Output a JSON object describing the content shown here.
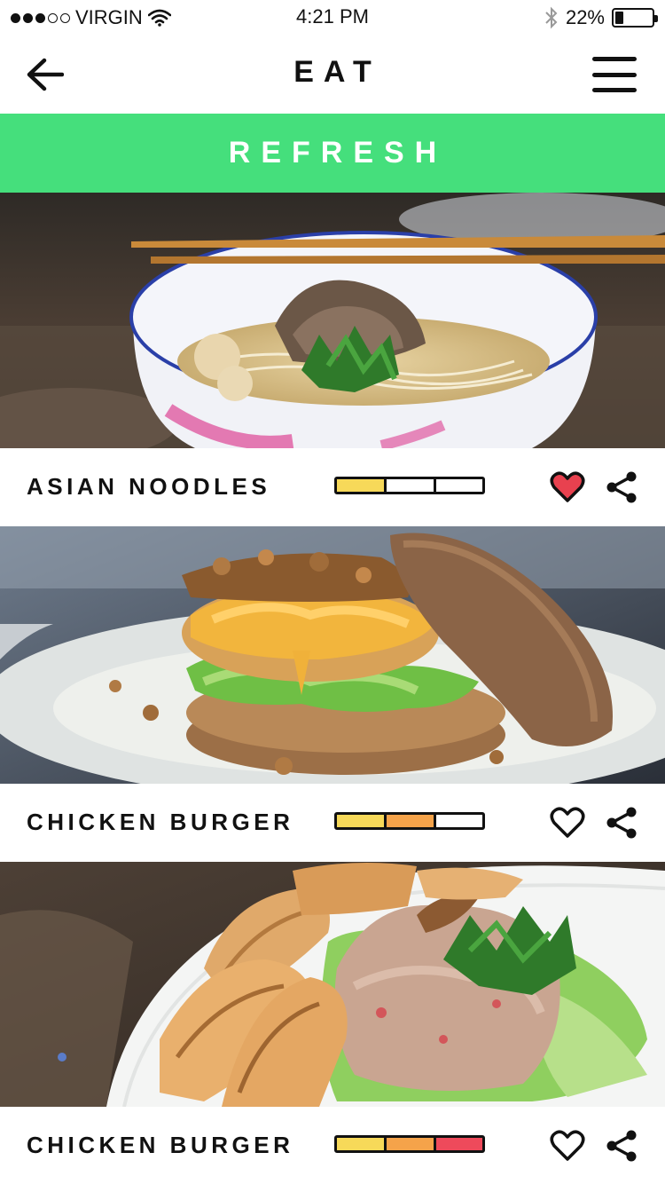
{
  "status_bar": {
    "carrier": "VIRGIN",
    "signal_strength": "3 of 5 dots",
    "time": "4:21 PM",
    "battery_percent": "22%",
    "battery_level": 0.22,
    "icons": [
      "wifi-icon",
      "bluetooth-icon",
      "battery-icon"
    ]
  },
  "nav": {
    "title": "EAT",
    "back_icon": "arrow-left-icon",
    "menu_icon": "hamburger-menu-icon"
  },
  "refresh": {
    "label": "REFRESH",
    "color": "#45df7c"
  },
  "colors": {
    "meter_yellow": "#f7d959",
    "meter_orange": "#f5a34a",
    "meter_red": "#ee4a5b",
    "heart_filled": "#e8414f"
  },
  "items": [
    {
      "name": "ASIAN NOODLES",
      "level": 0.33,
      "favorited": true,
      "image": "noodle-soup-bowl"
    },
    {
      "name": "CHICKEN BURGER",
      "level": 0.67,
      "favorited": false,
      "image": "chicken-burger-plate"
    },
    {
      "name": "CHICKEN BURGER",
      "level": 1.0,
      "favorited": false,
      "image": "tuna-salad-with-toast"
    }
  ]
}
